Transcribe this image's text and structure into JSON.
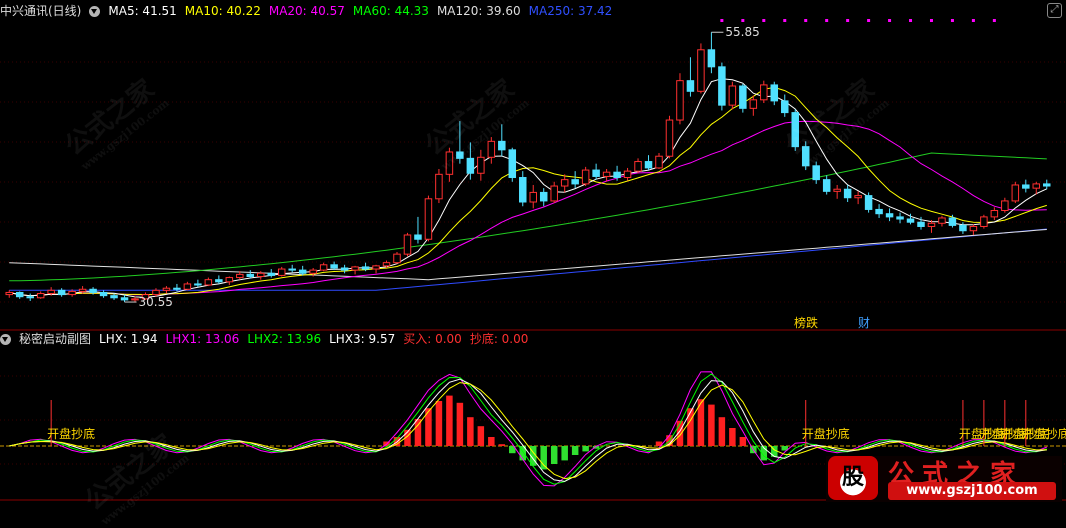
{
  "header": {
    "title": "中兴通讯(日线)",
    "ma": [
      {
        "label": "MA5: 41.51",
        "color": "#ffffff"
      },
      {
        "label": "MA10: 40.22",
        "color": "#ffff00"
      },
      {
        "label": "MA20: 40.57",
        "color": "#ff00ff"
      },
      {
        "label": "MA60: 44.33",
        "color": "#00ff00"
      },
      {
        "label": "MA120: 39.60",
        "color": "#dddddd"
      },
      {
        "label": "MA250: 37.42",
        "color": "#3050ff"
      }
    ]
  },
  "indicator": {
    "title": "秘密启动副图",
    "items": [
      {
        "label": "LHX: 1.94",
        "color": "#ffffff"
      },
      {
        "label": "LHX1: 13.06",
        "color": "#ff00ff"
      },
      {
        "label": "LHX2: 13.96",
        "color": "#00ff00"
      },
      {
        "label": "LHX3: 9.57",
        "color": "#ffffff"
      },
      {
        "label": "买入: 0.00",
        "color": "#ff3030"
      },
      {
        "label": "抄底: 0.00",
        "color": "#ff3030"
      }
    ],
    "signal_label": "开盘抄底"
  },
  "chart_data": {
    "type": "candlestick",
    "price_annotations": {
      "high": "55.85",
      "low": "30.55"
    },
    "event_tags": [
      "榜跌",
      "财"
    ],
    "price_range": [
      29,
      57
    ],
    "candles_note": "approximate daily OHLC, 100 sessions",
    "candles": [
      [
        31.2,
        31.6,
        30.9,
        31.4
      ],
      [
        31.4,
        31.5,
        30.8,
        31.0
      ],
      [
        31.0,
        31.3,
        30.6,
        30.9
      ],
      [
        30.9,
        31.5,
        30.8,
        31.3
      ],
      [
        31.3,
        31.9,
        31.1,
        31.6
      ],
      [
        31.6,
        31.8,
        31.0,
        31.2
      ],
      [
        31.2,
        31.7,
        31.0,
        31.5
      ],
      [
        31.5,
        32.0,
        31.3,
        31.7
      ],
      [
        31.7,
        31.9,
        31.2,
        31.4
      ],
      [
        31.4,
        31.6,
        30.9,
        31.1
      ],
      [
        31.1,
        31.3,
        30.7,
        30.9
      ],
      [
        30.9,
        31.2,
        30.5,
        30.7
      ],
      [
        30.7,
        31.0,
        30.55,
        30.8
      ],
      [
        30.8,
        31.4,
        30.7,
        31.2
      ],
      [
        31.2,
        31.8,
        31.0,
        31.6
      ],
      [
        31.6,
        32.0,
        31.3,
        31.8
      ],
      [
        31.8,
        32.2,
        31.5,
        31.7
      ],
      [
        31.7,
        32.4,
        31.6,
        32.2
      ],
      [
        32.2,
        32.6,
        31.9,
        32.1
      ],
      [
        32.1,
        32.8,
        32.0,
        32.6
      ],
      [
        32.6,
        33.0,
        32.2,
        32.4
      ],
      [
        32.4,
        32.9,
        32.1,
        32.8
      ],
      [
        32.8,
        33.4,
        32.6,
        33.1
      ],
      [
        33.1,
        33.5,
        32.7,
        32.9
      ],
      [
        32.9,
        33.4,
        32.6,
        33.2
      ],
      [
        33.2,
        33.6,
        32.8,
        33.0
      ],
      [
        33.0,
        33.8,
        32.9,
        33.6
      ],
      [
        33.6,
        34.0,
        33.3,
        33.5
      ],
      [
        33.5,
        33.9,
        33.0,
        33.2
      ],
      [
        33.2,
        33.7,
        32.9,
        33.5
      ],
      [
        33.5,
        34.2,
        33.4,
        34.0
      ],
      [
        34.0,
        34.3,
        33.5,
        33.7
      ],
      [
        33.7,
        34.0,
        33.2,
        33.5
      ],
      [
        33.5,
        33.9,
        33.1,
        33.8
      ],
      [
        33.8,
        34.2,
        33.4,
        33.6
      ],
      [
        33.6,
        34.0,
        33.2,
        33.9
      ],
      [
        33.9,
        34.4,
        33.7,
        34.2
      ],
      [
        34.2,
        35.2,
        34.1,
        35.0
      ],
      [
        35.0,
        37.0,
        34.8,
        36.8
      ],
      [
        36.8,
        38.5,
        36.0,
        36.4
      ],
      [
        36.4,
        40.5,
        36.2,
        40.2
      ],
      [
        40.2,
        43.0,
        39.8,
        42.5
      ],
      [
        42.5,
        45.0,
        41.8,
        44.6
      ],
      [
        44.6,
        47.5,
        43.5,
        44.0
      ],
      [
        44.0,
        45.5,
        42.0,
        42.6
      ],
      [
        42.6,
        44.8,
        41.9,
        44.1
      ],
      [
        44.1,
        46.0,
        43.5,
        45.6
      ],
      [
        45.6,
        47.2,
        44.2,
        44.8
      ],
      [
        44.8,
        45.0,
        41.8,
        42.2
      ],
      [
        42.2,
        42.8,
        39.5,
        39.9
      ],
      [
        39.9,
        41.5,
        39.3,
        40.8
      ],
      [
        40.8,
        41.2,
        39.5,
        40.0
      ],
      [
        40.0,
        41.8,
        39.8,
        41.4
      ],
      [
        41.4,
        42.5,
        40.8,
        42.0
      ],
      [
        42.0,
        42.8,
        41.2,
        41.6
      ],
      [
        41.6,
        43.2,
        41.4,
        42.9
      ],
      [
        42.9,
        43.5,
        42.0,
        42.3
      ],
      [
        42.3,
        43.0,
        41.8,
        42.7
      ],
      [
        42.7,
        43.3,
        41.9,
        42.2
      ],
      [
        42.2,
        43.1,
        41.9,
        42.8
      ],
      [
        42.8,
        44.0,
        42.6,
        43.7
      ],
      [
        43.7,
        44.3,
        42.9,
        43.1
      ],
      [
        43.1,
        44.5,
        43.0,
        44.2
      ],
      [
        44.2,
        48.0,
        44.0,
        47.6
      ],
      [
        47.6,
        52.0,
        47.2,
        51.3
      ],
      [
        51.3,
        53.5,
        49.8,
        50.3
      ],
      [
        50.3,
        54.8,
        50.1,
        54.2
      ],
      [
        54.2,
        55.85,
        52.0,
        52.6
      ],
      [
        52.6,
        53.0,
        48.5,
        49.0
      ],
      [
        49.0,
        51.2,
        48.6,
        50.8
      ],
      [
        50.8,
        51.0,
        48.3,
        48.7
      ],
      [
        48.7,
        49.9,
        48.0,
        49.5
      ],
      [
        49.5,
        51.3,
        49.2,
        50.9
      ],
      [
        50.9,
        51.2,
        49.0,
        49.4
      ],
      [
        49.4,
        50.0,
        47.9,
        48.3
      ],
      [
        48.3,
        48.6,
        44.7,
        45.1
      ],
      [
        45.1,
        45.6,
        42.9,
        43.3
      ],
      [
        43.3,
        43.7,
        41.6,
        42.0
      ],
      [
        42.0,
        42.4,
        40.6,
        40.9
      ],
      [
        40.9,
        41.5,
        40.2,
        41.1
      ],
      [
        41.1,
        41.5,
        39.9,
        40.3
      ],
      [
        40.3,
        40.9,
        39.7,
        40.5
      ],
      [
        40.5,
        40.8,
        38.9,
        39.2
      ],
      [
        39.2,
        39.7,
        38.4,
        38.8
      ],
      [
        38.8,
        39.3,
        38.1,
        38.5
      ],
      [
        38.5,
        38.9,
        37.9,
        38.3
      ],
      [
        38.3,
        38.8,
        37.8,
        38.0
      ],
      [
        38.0,
        38.5,
        37.3,
        37.6
      ],
      [
        37.6,
        38.2,
        37.0,
        37.9
      ],
      [
        37.9,
        38.6,
        37.6,
        38.4
      ],
      [
        38.4,
        38.7,
        37.5,
        37.7
      ],
      [
        37.7,
        38.0,
        36.9,
        37.2
      ],
      [
        37.2,
        37.8,
        36.8,
        37.6
      ],
      [
        37.6,
        38.7,
        37.4,
        38.5
      ],
      [
        38.5,
        39.4,
        38.2,
        39.1
      ],
      [
        39.1,
        40.3,
        38.9,
        40.0
      ],
      [
        40.0,
        41.8,
        39.8,
        41.5
      ],
      [
        41.5,
        42.0,
        40.8,
        41.2
      ],
      [
        41.2,
        41.8,
        40.6,
        41.6
      ],
      [
        41.6,
        42.0,
        41.1,
        41.4
      ]
    ],
    "indicator_bars": [
      0,
      0,
      0,
      0,
      0,
      0,
      0,
      0,
      0,
      0,
      0,
      0,
      0,
      0,
      0,
      0,
      0,
      0,
      0,
      0,
      0,
      0,
      0,
      0,
      0,
      0,
      0,
      0,
      0,
      0,
      0,
      0,
      0,
      0,
      0,
      0,
      0.5,
      1.0,
      1.8,
      3.0,
      4.2,
      5.0,
      5.6,
      4.8,
      3.2,
      2.2,
      1.0,
      0.2,
      -0.8,
      -1.6,
      -2.2,
      -2.6,
      -2.0,
      -1.6,
      -1.0,
      -0.6,
      -0.3,
      0,
      0,
      0,
      0,
      0,
      0.5,
      1.2,
      2.8,
      4.2,
      5.2,
      4.6,
      3.2,
      2.0,
      1.0,
      -0.8,
      -1.6,
      -1.2,
      -0.5,
      0,
      0,
      0,
      0,
      0,
      0,
      0,
      0,
      0,
      0,
      0,
      0,
      0,
      0,
      0,
      0,
      0,
      0,
      0,
      0,
      0,
      0,
      0,
      0,
      0
    ],
    "signals_at": [
      4,
      76,
      91,
      93,
      95,
      97
    ]
  },
  "watermark": {
    "text": "公式之家",
    "url": "www.gszj100.com"
  },
  "logo": {
    "mark": "股",
    "text": "公式之家",
    "url": "www.gszj100.com"
  }
}
